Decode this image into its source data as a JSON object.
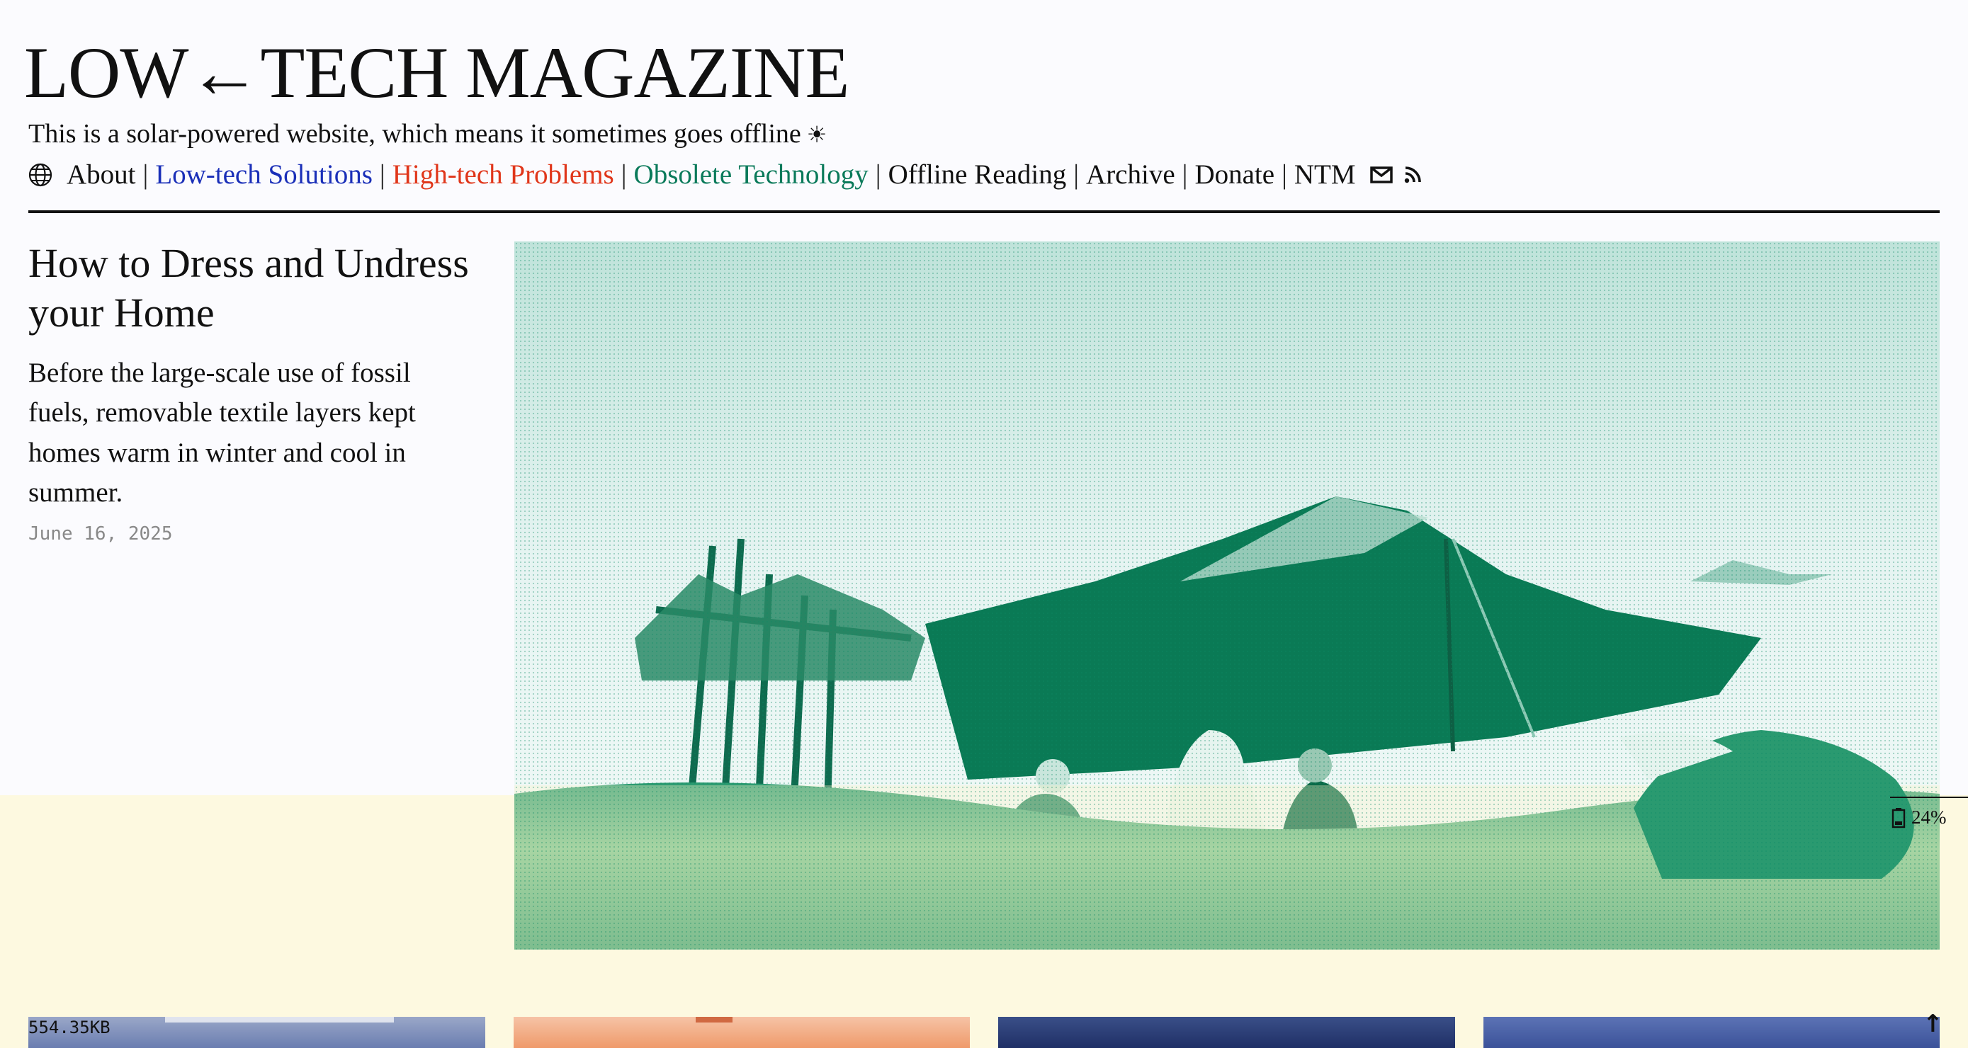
{
  "site": {
    "title": "LOW←TECH MAGAZINE",
    "tagline": "This is a solar-powered website, which means it sometimes goes offline",
    "tagline_symbol": "☀"
  },
  "nav": {
    "items": [
      {
        "label": "About",
        "color": "#111111"
      },
      {
        "label": "Low-tech Solutions",
        "color": "#1a2fb8"
      },
      {
        "label": "High-tech Problems",
        "color": "#e0361a"
      },
      {
        "label": "Obsolete Technology",
        "color": "#0a7a5a"
      },
      {
        "label": "Offline Reading",
        "color": "#111111"
      },
      {
        "label": "Archive",
        "color": "#111111"
      },
      {
        "label": "Donate",
        "color": "#111111"
      },
      {
        "label": "NTM",
        "color": "#111111"
      }
    ],
    "separator": "|",
    "icons": [
      "globe-icon",
      "mail-icon",
      "rss-icon"
    ]
  },
  "feature": {
    "title": "How to Dress and Undress your Home",
    "excerpt": "Before the large-scale use of fossil fuels, removable textile layers kept homes warm in winter and cool in summer.",
    "date": "June 16, 2025"
  },
  "battery": {
    "level": 24,
    "label": "24%",
    "background_color": "#fdf9e0"
  },
  "footer": {
    "page_size": "554.35KB",
    "to_top": "↑"
  },
  "colors": {
    "background": "#fbfbfe",
    "text": "#111111",
    "duotone_green": "#0a8a63",
    "duotone_light": "#d6efe6"
  }
}
